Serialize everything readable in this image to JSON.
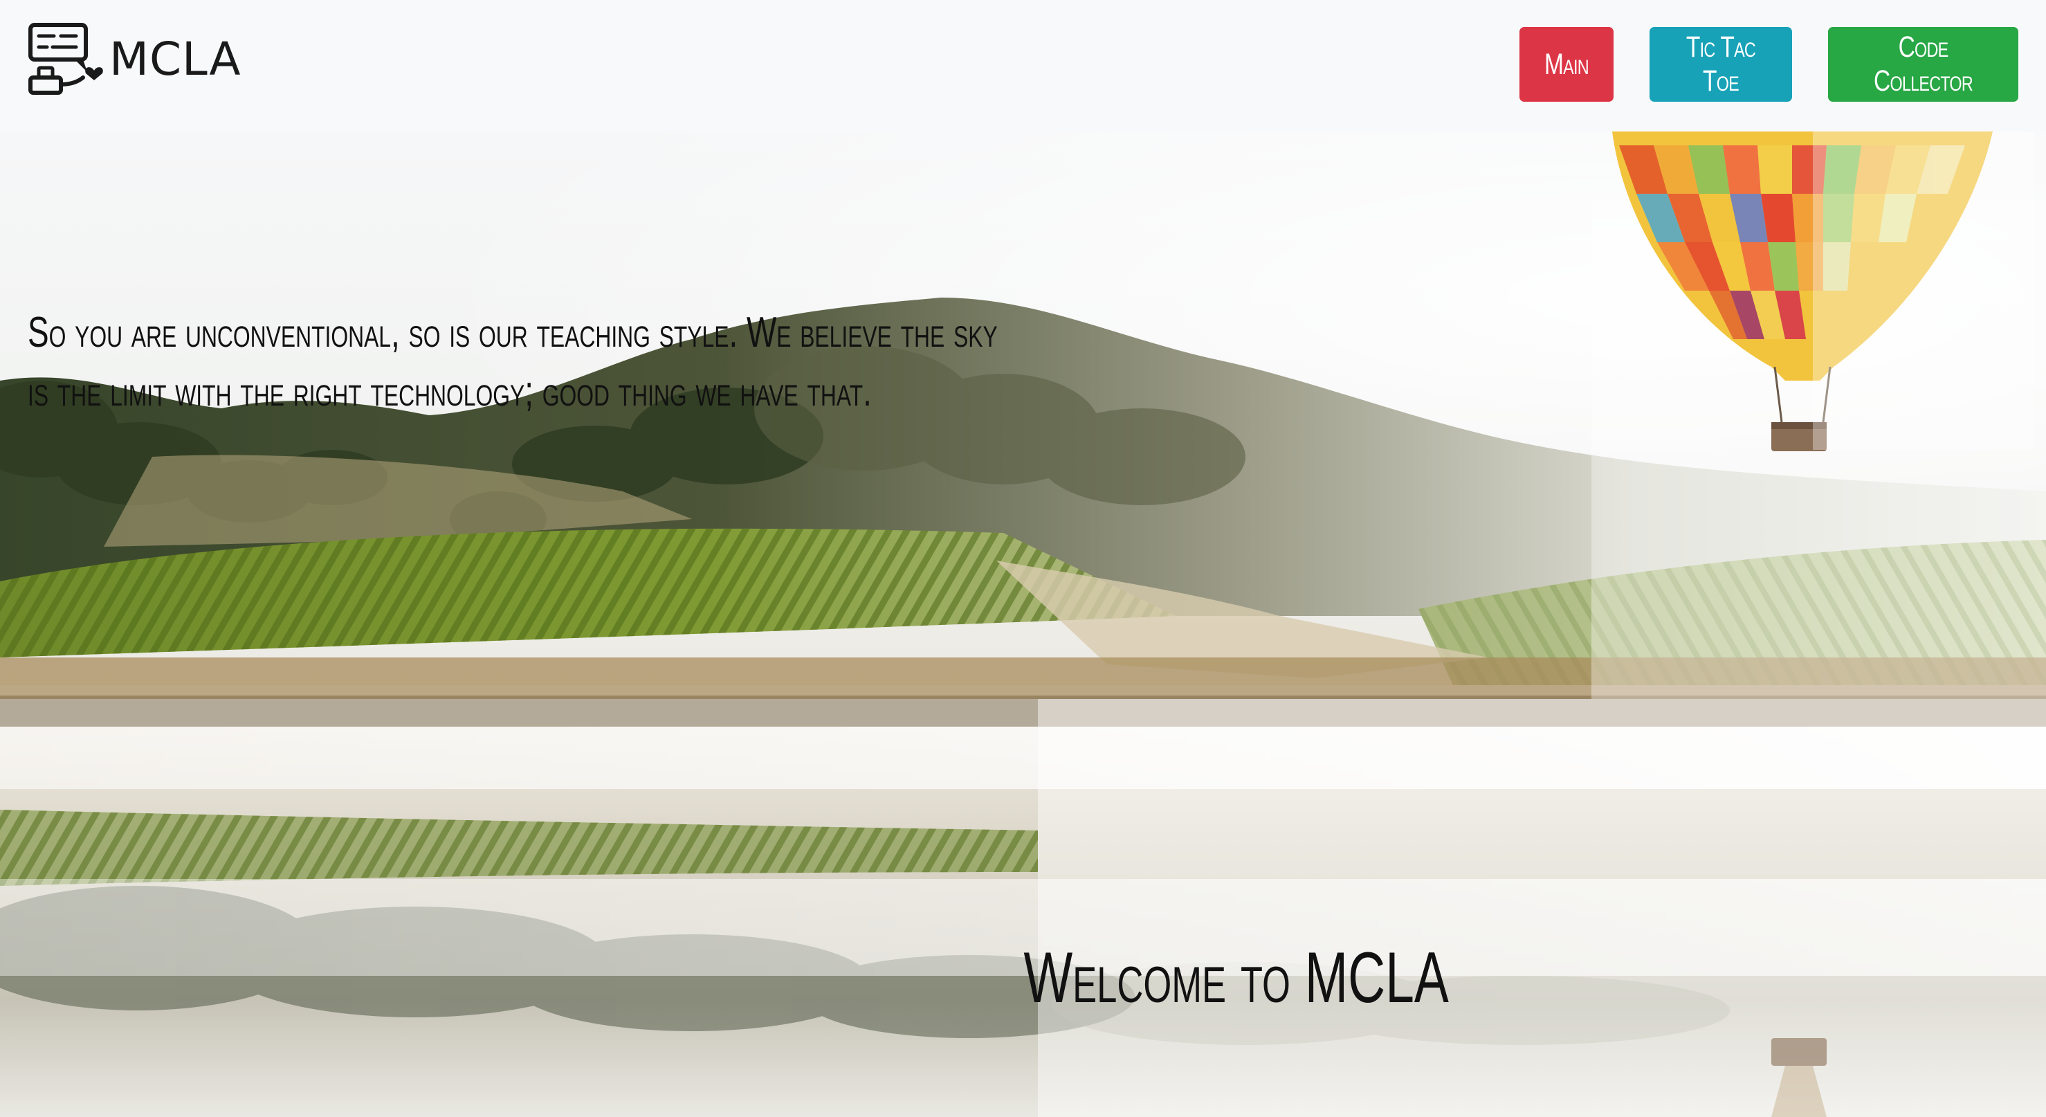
{
  "navbar": {
    "brand_name": "MCLA",
    "logo_icon": "chat-computer-logo-icon",
    "buttons": [
      {
        "label": "Main",
        "color": "#dc3545"
      },
      {
        "label": "Tic Tac Toe",
        "color": "#17a2b8"
      },
      {
        "label": "Code Collector",
        "color": "#28a745"
      }
    ]
  },
  "hero": {
    "tagline": "So you are unconventional, so is our teaching style. We believe the sky is the limit with the right technology; good thing we have that.",
    "welcome_heading": "Welcome to MCLA",
    "background_image": "misty-vineyard-lake-hot-air-balloon"
  }
}
